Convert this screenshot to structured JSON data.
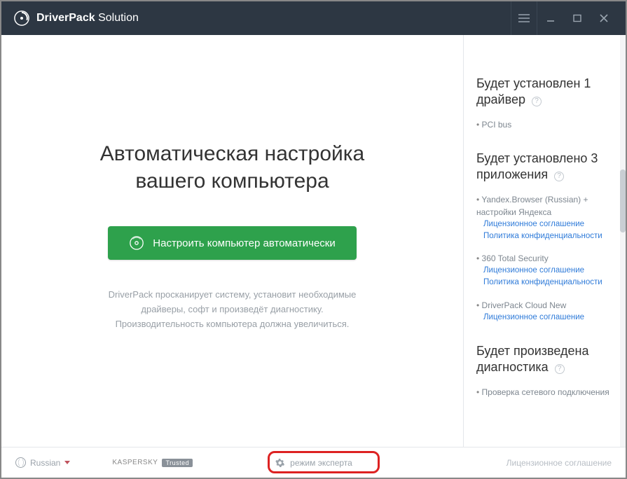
{
  "titlebar": {
    "brand_bold": "DriverPack",
    "brand_light": " Solution"
  },
  "main": {
    "heading_line1": "Автоматическая настройка",
    "heading_line2": "вашего компьютера",
    "cta_label": "Настроить компьютер автоматически",
    "desc_line1": "DriverPack просканирует систему, установит необходимые",
    "desc_line2": "драйверы, софт и произведёт диагностику.",
    "desc_line3": "Производительность компьютера должна увеличиться."
  },
  "sidebar": {
    "drivers": {
      "heading": "Будет установлен 1 драйвер",
      "items": [
        {
          "name": "PCI bus"
        }
      ]
    },
    "apps": {
      "heading": "Будет установлено 3 приложения",
      "items": [
        {
          "name": "Yandex.Browser (Russian) + настройки Яндекса",
          "links": [
            "Лицензионное соглашение",
            "Политика конфиденциальности"
          ]
        },
        {
          "name": "360 Total Security",
          "links": [
            "Лицензионное соглашение",
            "Политика конфиденциальности"
          ]
        },
        {
          "name": "DriverPack Cloud New",
          "links": [
            "Лицензионное соглашение"
          ]
        }
      ]
    },
    "diag": {
      "heading": "Будет произведена диагностика",
      "items": [
        {
          "name": "Проверка сетевого подключения"
        }
      ]
    }
  },
  "footer": {
    "language": "Russian",
    "kaspersky_label": "KASPERSKY",
    "kaspersky_badge": "Trusted",
    "expert_label": "режим эксперта",
    "license_link": "Лицензионное соглашение"
  }
}
